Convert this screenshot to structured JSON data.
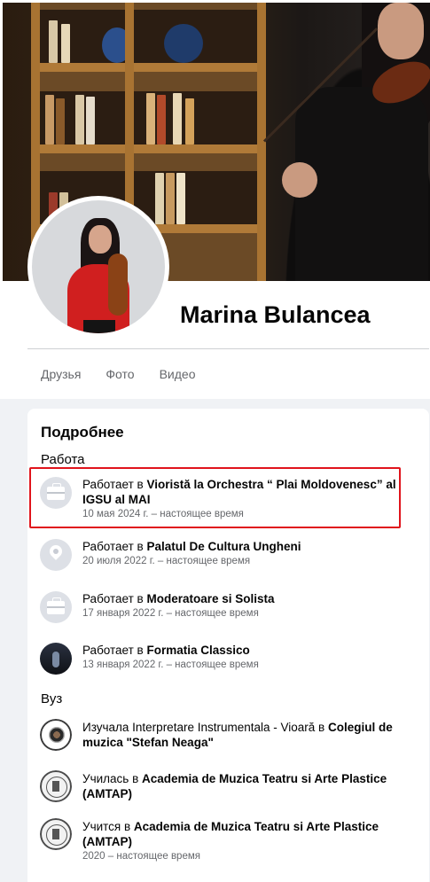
{
  "profile": {
    "name": "Marina Bulancea"
  },
  "tabs": [
    "Друзья",
    "Фото",
    "Видео"
  ],
  "about": {
    "title": "Подробнее",
    "work_heading": "Работа",
    "work": [
      {
        "prefix": "Работает в ",
        "place": "Vioristă la Orchestra “ Plai Moldovenesc” al IGSU al MAI",
        "date": "10 мая 2024 г. – настоящее время",
        "icon": "briefcase-icon"
      },
      {
        "prefix": "Работает в ",
        "place": "Palatul De Cultura Ungheni",
        "date": "20 июля 2022 г. – настоящее время",
        "icon": "location-pin-icon"
      },
      {
        "prefix": "Работает в ",
        "place": "Moderatoare si Solista",
        "date": "17 января 2022 г. – настоящее время",
        "icon": "briefcase-icon"
      },
      {
        "prefix": "Работает в ",
        "place": "Formatia Classico",
        "date": "13 января 2022 г. – настоящее время",
        "icon": "stage-photo-icon"
      }
    ],
    "edu_heading": "Вуз",
    "education": [
      {
        "prefix": "Изучала Interpretare Instrumentala - Vioară в ",
        "place": "Colegiul de muzica \"Stefan Neaga\"",
        "date": "",
        "icon": "college-logo-icon"
      },
      {
        "prefix": "Училась в ",
        "place": "Academia de Muzica Teatru si Arte Plastice (AMTAP)",
        "date": "",
        "icon": "academy-logo-icon"
      },
      {
        "prefix": "Учится в ",
        "place": "Academia de Muzica Teatru si Arte Plastice (AMTAP)",
        "date": "2020 – настоящее время",
        "icon": "academy-logo-icon"
      }
    ]
  },
  "colors": {
    "highlight": "#e0141c",
    "page_bg": "#f0f2f5",
    "secondary_text": "#65676b"
  }
}
